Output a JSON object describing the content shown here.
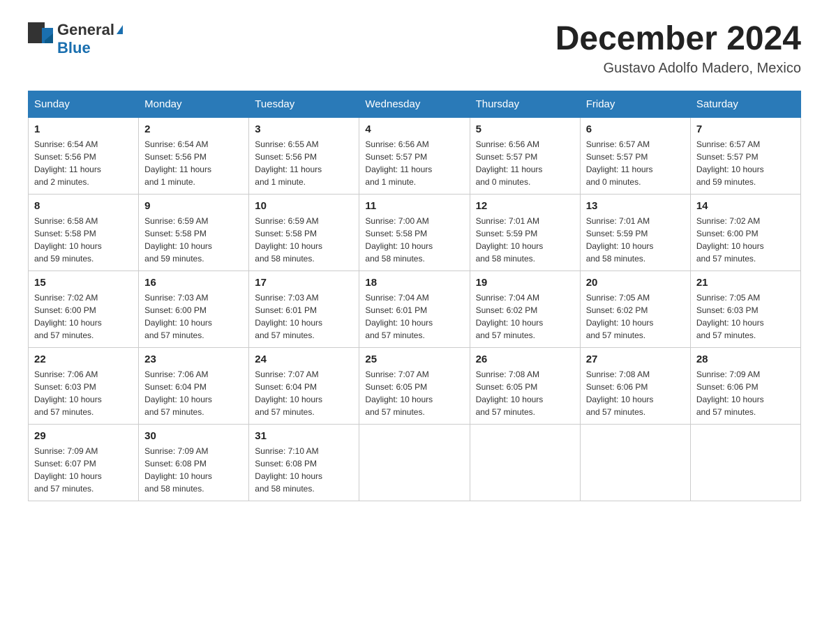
{
  "header": {
    "logo_general": "General",
    "logo_blue": "Blue",
    "month_title": "December 2024",
    "location": "Gustavo Adolfo Madero, Mexico"
  },
  "days_of_week": [
    "Sunday",
    "Monday",
    "Tuesday",
    "Wednesday",
    "Thursday",
    "Friday",
    "Saturday"
  ],
  "weeks": [
    [
      {
        "day": "1",
        "sunrise": "6:54 AM",
        "sunset": "5:56 PM",
        "daylight": "11 hours and 2 minutes."
      },
      {
        "day": "2",
        "sunrise": "6:54 AM",
        "sunset": "5:56 PM",
        "daylight": "11 hours and 1 minute."
      },
      {
        "day": "3",
        "sunrise": "6:55 AM",
        "sunset": "5:56 PM",
        "daylight": "11 hours and 1 minute."
      },
      {
        "day": "4",
        "sunrise": "6:56 AM",
        "sunset": "5:57 PM",
        "daylight": "11 hours and 1 minute."
      },
      {
        "day": "5",
        "sunrise": "6:56 AM",
        "sunset": "5:57 PM",
        "daylight": "11 hours and 0 minutes."
      },
      {
        "day": "6",
        "sunrise": "6:57 AM",
        "sunset": "5:57 PM",
        "daylight": "11 hours and 0 minutes."
      },
      {
        "day": "7",
        "sunrise": "6:57 AM",
        "sunset": "5:57 PM",
        "daylight": "10 hours and 59 minutes."
      }
    ],
    [
      {
        "day": "8",
        "sunrise": "6:58 AM",
        "sunset": "5:58 PM",
        "daylight": "10 hours and 59 minutes."
      },
      {
        "day": "9",
        "sunrise": "6:59 AM",
        "sunset": "5:58 PM",
        "daylight": "10 hours and 59 minutes."
      },
      {
        "day": "10",
        "sunrise": "6:59 AM",
        "sunset": "5:58 PM",
        "daylight": "10 hours and 58 minutes."
      },
      {
        "day": "11",
        "sunrise": "7:00 AM",
        "sunset": "5:58 PM",
        "daylight": "10 hours and 58 minutes."
      },
      {
        "day": "12",
        "sunrise": "7:01 AM",
        "sunset": "5:59 PM",
        "daylight": "10 hours and 58 minutes."
      },
      {
        "day": "13",
        "sunrise": "7:01 AM",
        "sunset": "5:59 PM",
        "daylight": "10 hours and 58 minutes."
      },
      {
        "day": "14",
        "sunrise": "7:02 AM",
        "sunset": "6:00 PM",
        "daylight": "10 hours and 57 minutes."
      }
    ],
    [
      {
        "day": "15",
        "sunrise": "7:02 AM",
        "sunset": "6:00 PM",
        "daylight": "10 hours and 57 minutes."
      },
      {
        "day": "16",
        "sunrise": "7:03 AM",
        "sunset": "6:00 PM",
        "daylight": "10 hours and 57 minutes."
      },
      {
        "day": "17",
        "sunrise": "7:03 AM",
        "sunset": "6:01 PM",
        "daylight": "10 hours and 57 minutes."
      },
      {
        "day": "18",
        "sunrise": "7:04 AM",
        "sunset": "6:01 PM",
        "daylight": "10 hours and 57 minutes."
      },
      {
        "day": "19",
        "sunrise": "7:04 AM",
        "sunset": "6:02 PM",
        "daylight": "10 hours and 57 minutes."
      },
      {
        "day": "20",
        "sunrise": "7:05 AM",
        "sunset": "6:02 PM",
        "daylight": "10 hours and 57 minutes."
      },
      {
        "day": "21",
        "sunrise": "7:05 AM",
        "sunset": "6:03 PM",
        "daylight": "10 hours and 57 minutes."
      }
    ],
    [
      {
        "day": "22",
        "sunrise": "7:06 AM",
        "sunset": "6:03 PM",
        "daylight": "10 hours and 57 minutes."
      },
      {
        "day": "23",
        "sunrise": "7:06 AM",
        "sunset": "6:04 PM",
        "daylight": "10 hours and 57 minutes."
      },
      {
        "day": "24",
        "sunrise": "7:07 AM",
        "sunset": "6:04 PM",
        "daylight": "10 hours and 57 minutes."
      },
      {
        "day": "25",
        "sunrise": "7:07 AM",
        "sunset": "6:05 PM",
        "daylight": "10 hours and 57 minutes."
      },
      {
        "day": "26",
        "sunrise": "7:08 AM",
        "sunset": "6:05 PM",
        "daylight": "10 hours and 57 minutes."
      },
      {
        "day": "27",
        "sunrise": "7:08 AM",
        "sunset": "6:06 PM",
        "daylight": "10 hours and 57 minutes."
      },
      {
        "day": "28",
        "sunrise": "7:09 AM",
        "sunset": "6:06 PM",
        "daylight": "10 hours and 57 minutes."
      }
    ],
    [
      {
        "day": "29",
        "sunrise": "7:09 AM",
        "sunset": "6:07 PM",
        "daylight": "10 hours and 57 minutes."
      },
      {
        "day": "30",
        "sunrise": "7:09 AM",
        "sunset": "6:08 PM",
        "daylight": "10 hours and 58 minutes."
      },
      {
        "day": "31",
        "sunrise": "7:10 AM",
        "sunset": "6:08 PM",
        "daylight": "10 hours and 58 minutes."
      },
      null,
      null,
      null,
      null
    ]
  ],
  "labels": {
    "sunrise": "Sunrise:",
    "sunset": "Sunset:",
    "daylight": "Daylight:"
  }
}
